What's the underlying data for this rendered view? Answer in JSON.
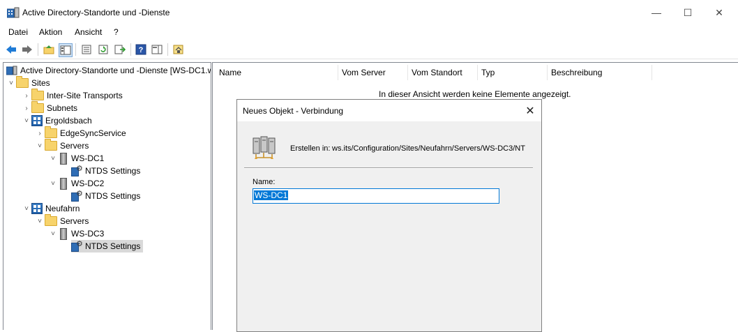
{
  "window": {
    "title": "Active Directory-Standorte und -Dienste",
    "controls": {
      "minimize": "—",
      "maximize": "☐",
      "close": "✕"
    }
  },
  "menu": [
    "Datei",
    "Aktion",
    "Ansicht",
    "?"
  ],
  "toolbar": {
    "icons": [
      "back-icon",
      "forward-icon",
      "up-folder-icon",
      "show-hide-tree-icon",
      "properties-icon",
      "refresh-icon",
      "export-list-icon",
      "help-icon",
      "action-pane-icon",
      "new-connection-icon"
    ]
  },
  "tree": {
    "root": "Active Directory-Standorte und -Dienste [WS-DC1.w",
    "items": [
      {
        "label": "Sites",
        "chevron": "˅",
        "icon": "folder-icon"
      },
      {
        "label": "Inter-Site Transports",
        "chevron": "›",
        "icon": "folder-icon"
      },
      {
        "label": "Subnets",
        "chevron": "›",
        "icon": "folder-icon"
      },
      {
        "label": "Ergoldsbach",
        "chevron": "˅",
        "icon": "site-icon"
      },
      {
        "label": "EdgeSyncService",
        "chevron": "›",
        "icon": "folder-icon"
      },
      {
        "label": "Servers",
        "chevron": "˅",
        "icon": "folder-icon"
      },
      {
        "label": "WS-DC1",
        "chevron": "˅",
        "icon": "server-icon"
      },
      {
        "label": "NTDS Settings",
        "chevron": "",
        "icon": "ntds-settings-icon"
      },
      {
        "label": "WS-DC2",
        "chevron": "˅",
        "icon": "server-icon"
      },
      {
        "label": "NTDS Settings",
        "chevron": "",
        "icon": "ntds-settings-icon"
      },
      {
        "label": "Neufahrn",
        "chevron": "˅",
        "icon": "site-icon"
      },
      {
        "label": "Servers",
        "chevron": "˅",
        "icon": "folder-icon"
      },
      {
        "label": "WS-DC3",
        "chevron": "˅",
        "icon": "server-icon"
      },
      {
        "label": "NTDS Settings",
        "chevron": "",
        "icon": "ntds-settings-icon",
        "selected": true
      }
    ]
  },
  "list": {
    "columns": [
      "Name",
      "Vom Server",
      "Vom Standort",
      "Typ",
      "Beschreibung"
    ],
    "empty_message": "In dieser Ansicht werden keine Elemente angezeigt."
  },
  "dialog": {
    "title": "Neues Objekt - Verbindung",
    "close": "✕",
    "create_in_label": "Erstellen in:",
    "create_in_path": "ws.its/Configuration/Sites/Neufahrn/Servers/WS-DC3/NT",
    "name_label": "Name:",
    "name_value": "WS-DC1"
  },
  "colors": {
    "selection": "#d9d9d9",
    "focus_blue": "#0078d7",
    "dialog_bg": "#f0f0f0"
  }
}
